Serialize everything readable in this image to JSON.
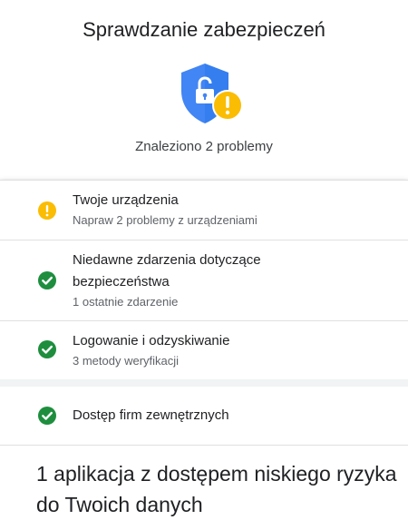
{
  "page": {
    "title": "Sprawdzanie zabezpieczeń",
    "summary": "Znaleziono 2 problemy"
  },
  "colors": {
    "shield_blue": "#4285f4",
    "warning_yellow": "#fbbc04",
    "check_green": "#1e8e3e"
  },
  "checks": [
    {
      "title": "Twoje urządzenia",
      "subtitle": "Napraw 2 problemy z urządzeniami",
      "status": "warning",
      "icon": "warning-icon"
    },
    {
      "title": "Niedawne zdarzenia dotyczące bezpieczeństwa",
      "subtitle": "1 ostatnie zdarzenie",
      "status": "ok",
      "icon": "check-circle-icon"
    },
    {
      "title": "Logowanie i odzyskiwanie",
      "subtitle": "3 metody weryfikacji",
      "status": "ok",
      "icon": "check-circle-icon"
    }
  ],
  "third_party": {
    "title": "Dostęp firm zewnętrznych",
    "status": "ok",
    "icon": "check-circle-icon"
  },
  "bottom_heading": "1 aplikacja z dostępem niskiego ryzyka do Twoich danych"
}
